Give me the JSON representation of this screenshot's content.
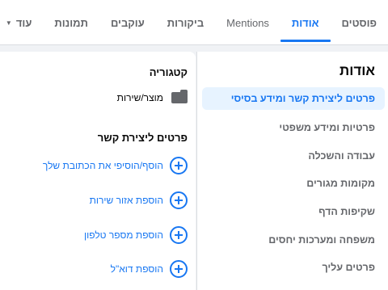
{
  "tabs": [
    {
      "label": "פוסטים",
      "active": false
    },
    {
      "label": "אודות",
      "active": true
    },
    {
      "label": "Mentions",
      "active": false
    },
    {
      "label": "ביקורות",
      "active": false
    },
    {
      "label": "עוקבים",
      "active": false
    },
    {
      "label": "תמונות",
      "active": false
    },
    {
      "label": "עוד",
      "active": false,
      "icon": "caret-down-icon"
    }
  ],
  "sidebar": {
    "title": "אודות",
    "items": [
      {
        "label": "פרטים ליצירת קשר ומידע בסיסי",
        "active": true
      },
      {
        "label": "פרטיות ומידע משפטי",
        "active": false
      },
      {
        "label": "עבודה והשכלה",
        "active": false
      },
      {
        "label": "מקומות מגורים",
        "active": false
      },
      {
        "label": "שקיפות הדף",
        "active": false
      },
      {
        "label": "משפחה ומערכות יחסים",
        "active": false
      },
      {
        "label": "פרטים עליך",
        "active": false
      }
    ]
  },
  "main": {
    "category": {
      "title": "קטגוריה",
      "value": "מוצר/שירות",
      "icon": "folder-icon"
    },
    "contact": {
      "title": "פרטים ליצירת קשר",
      "actions": [
        {
          "label": "הוסף/הוסיפי את הכתובת שלך",
          "icon": "plus-circle-icon"
        },
        {
          "label": "הוספת אזור שירות",
          "icon": "plus-circle-icon"
        },
        {
          "label": "הוספת מספר טלפון",
          "icon": "plus-circle-icon"
        },
        {
          "label": "הוספת דוא\"ל",
          "icon": "plus-circle-icon"
        }
      ]
    }
  },
  "colors": {
    "accent": "#1877f2",
    "active_bg": "#e7f3ff",
    "muted_text": "#65676b",
    "page_bg": "#f0f2f5"
  }
}
